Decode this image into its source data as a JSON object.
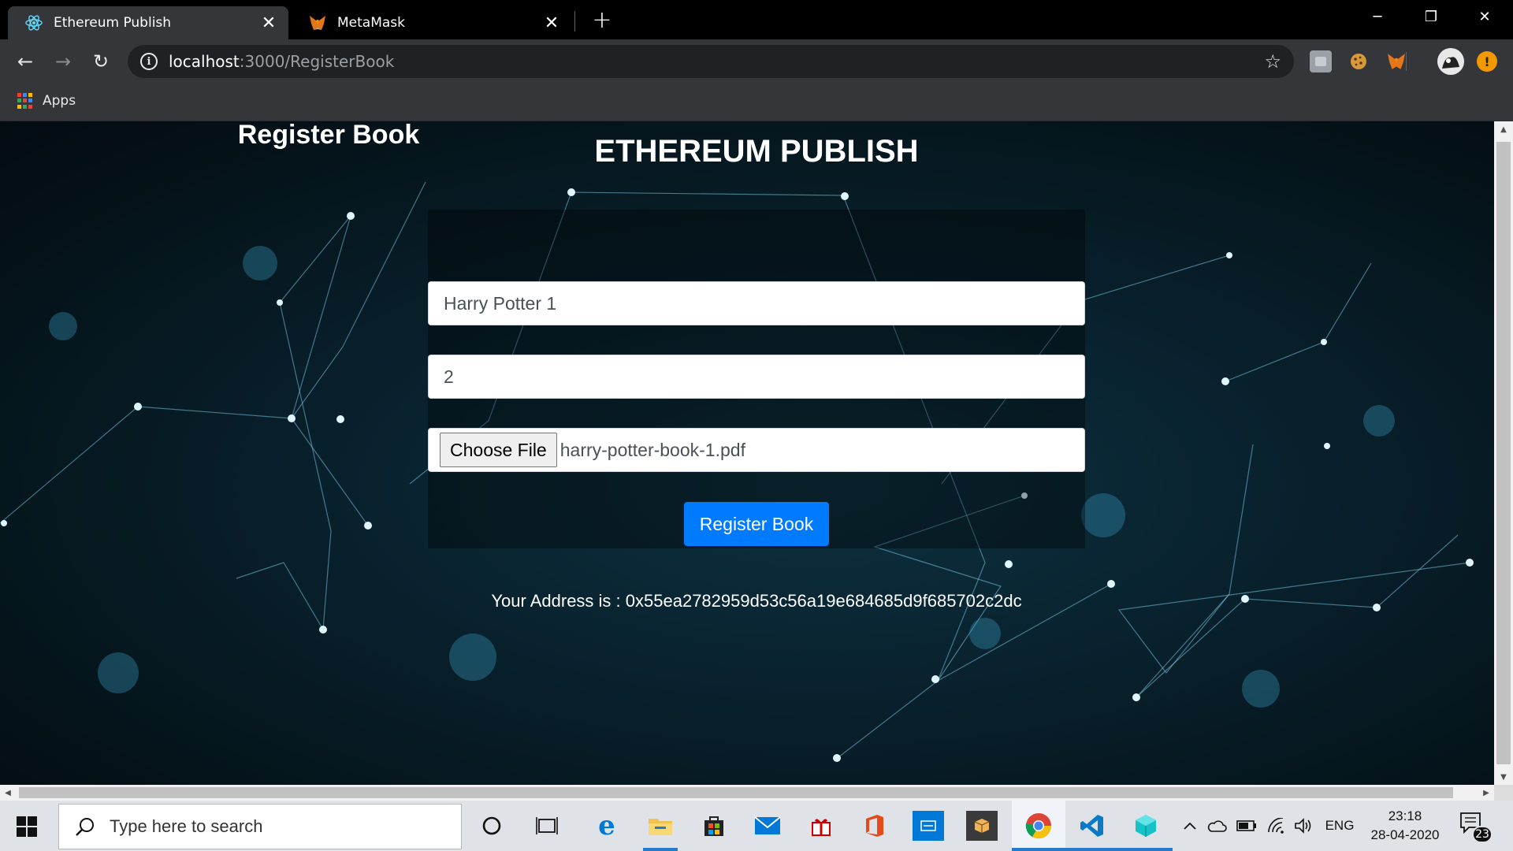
{
  "browser": {
    "tabs": [
      {
        "title": "Ethereum Publish",
        "icon": "react-icon",
        "active": true
      },
      {
        "title": "MetaMask",
        "icon": "metamask-fox-icon",
        "active": false
      }
    ],
    "url_host": "localhost",
    "url_path": ":3000/RegisterBook",
    "bookmarks": [
      {
        "label": "Apps",
        "icon": "apps-grid-icon"
      }
    ]
  },
  "page": {
    "heading": "ETHEREUM PUBLISH",
    "form": {
      "title": "Register Book",
      "book_name_value": "Harry Potter 1",
      "price_value": "2",
      "file_button_label": "Choose File",
      "file_name": "harry-potter-book-1.pdf",
      "submit_label": "Register Book"
    },
    "address_label": "Your Address is : ",
    "address_value": "0x55ea2782959d53c56a19e684685d9f685702c2dc"
  },
  "taskbar": {
    "search_placeholder": "Type here to search",
    "tray": {
      "language": "ENG",
      "time": "23:18",
      "date": "28-04-2020",
      "notification_count": "23"
    }
  },
  "colors": {
    "primary_button": "#007bff",
    "tab_active": "#35363a",
    "taskbar": "#dfe3e8"
  }
}
